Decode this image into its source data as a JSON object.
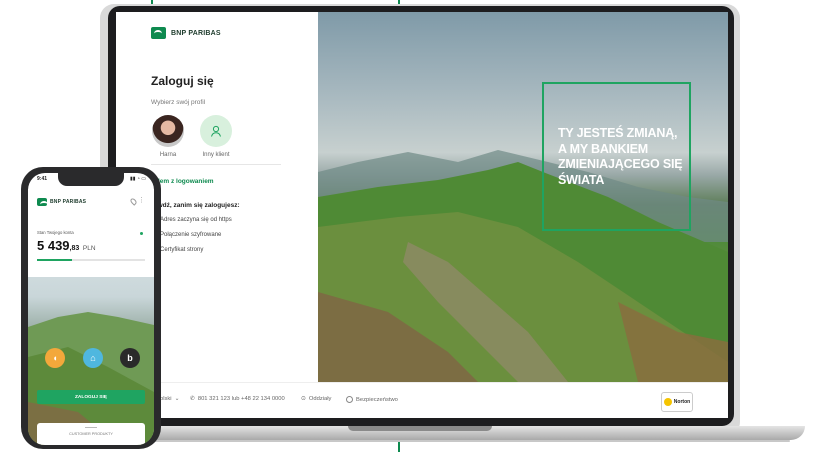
{
  "colors": {
    "brand_green": "#0e8a4f",
    "accent_green": "#1fa461"
  },
  "brand": {
    "name": "BNP PARIBAS"
  },
  "login": {
    "title": "Zaloguj się",
    "subtitle": "Wybierz swój profil",
    "profiles": [
      {
        "name": "Harna",
        "icon": "user-photo"
      },
      {
        "name": "Inny klient",
        "icon": "user-outline-icon"
      }
    ],
    "help_link": "blem z logowaniem",
    "checklist_title": "awdź, zanim się zalogujesz:",
    "checklist": [
      "Adres zaczyna się od https",
      "Połączenie szyfrowane",
      "Certyfikat strony"
    ]
  },
  "hero": {
    "lines": [
      "TY JESTEŚ ZMIANĄ,",
      "A MY BANKIEM",
      "ZMIENIAJĄCEGO SIĘ",
      "ŚWIATA"
    ]
  },
  "footer": {
    "language": "olski",
    "phone": "801 321 123 lub +48 22 134 0000",
    "branches": "Oddziały",
    "security": "Bezpieczeństwo",
    "norton": "Norton"
  },
  "phone": {
    "time": "9:41",
    "balance_label": "Stan Twojego konta",
    "balance_main": "5 439",
    "balance_decimal": ",83",
    "currency": "PLN",
    "balance_progress": 0.32,
    "login_button": "ZALOGUJ SIĘ",
    "bottom_label": "CUSTOMER PRODUKTY"
  }
}
